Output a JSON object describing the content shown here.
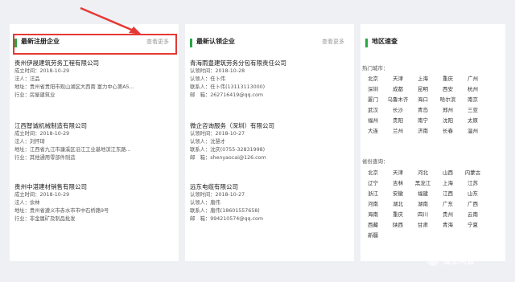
{
  "left": {
    "title": "最新注册企业",
    "more": "查看更多",
    "companies": [
      {
        "name": "贵州伊晟建筑劳务工程有限公司",
        "lines": [
          "成立时间：2018-10-29",
          "法人：汪品",
          "地址：贵州省贵阳市观山湖区大西南 富力中心第A5...",
          "行业：房屋建筑业"
        ]
      },
      {
        "name": "江西智诚机械制造有限公司",
        "lines": [
          "成立时间：2018-10-29",
          "法人：刘怀琦",
          "地址：江西省九江市濂溪区沿江工业基地滨江东路...",
          "行业：其他通用零部件制造"
        ]
      },
      {
        "name": "贵州中湛建材销售有限公司",
        "lines": [
          "成立时间：2018-10-29",
          "法人：余林",
          "地址：贵州省遵义市赤水市市中石桥路9号",
          "行业：非金属矿及制品批发"
        ]
      }
    ]
  },
  "middle": {
    "title": "最新认领企业",
    "more": "查看更多",
    "companies": [
      {
        "name": "青海雨豊建筑劳务分包有限责任公司",
        "lines": [
          "认领时间：2018-10-28",
          "认领人：任卜伟",
          "联系人：任卜伟(13113113000)",
          "邮　箱：262716419@qq.com"
        ]
      },
      {
        "name": "微企咨询服务（深圳）有限公司",
        "lines": [
          "认领时间：2018-10-27",
          "认领人：沈慧才",
          "联系人：沈庆(0755-32831998)",
          "邮　箱：shenyaocai@126.com"
        ]
      },
      {
        "name": "远东电缆有限公司",
        "lines": [
          "认领时间：2018-10-27",
          "认领人：唐伟",
          "联系人：唐伟(18601557658)",
          "邮　箱：994210574@qq.com"
        ]
      }
    ]
  },
  "right": {
    "title": "地区速查",
    "hot_label": "热门城市：",
    "hot_cities": [
      "北京",
      "天津",
      "上海",
      "重庆",
      "广州",
      "深圳",
      "成都",
      "昆明",
      "西安",
      "杭州",
      "厦门",
      "乌鲁木齐",
      "海口",
      "哈尔滨",
      "南京",
      "武汉",
      "长沙",
      "青岛",
      "郑州",
      "三亚",
      "福州",
      "贵阳",
      "南宁",
      "沈阳",
      "太原",
      "大连",
      "兰州",
      "济南",
      "长春",
      "温州"
    ],
    "prov_label": "省份查询：",
    "provinces": [
      "北京",
      "天津",
      "河北",
      "山西",
      "内蒙古",
      "辽宁",
      "吉林",
      "黑龙江",
      "上海",
      "江苏",
      "浙江",
      "安徽",
      "福建",
      "江西",
      "山东",
      "河南",
      "湖北",
      "湖南",
      "广东",
      "广西",
      "海南",
      "重庆",
      "四川",
      "贵州",
      "云南",
      "西藏",
      "陕西",
      "甘肃",
      "青海",
      "宁夏",
      "新疆"
    ]
  },
  "watermark": "悟空问答",
  "colors": {
    "accent": "#28a745",
    "highlight": "#e53935"
  }
}
